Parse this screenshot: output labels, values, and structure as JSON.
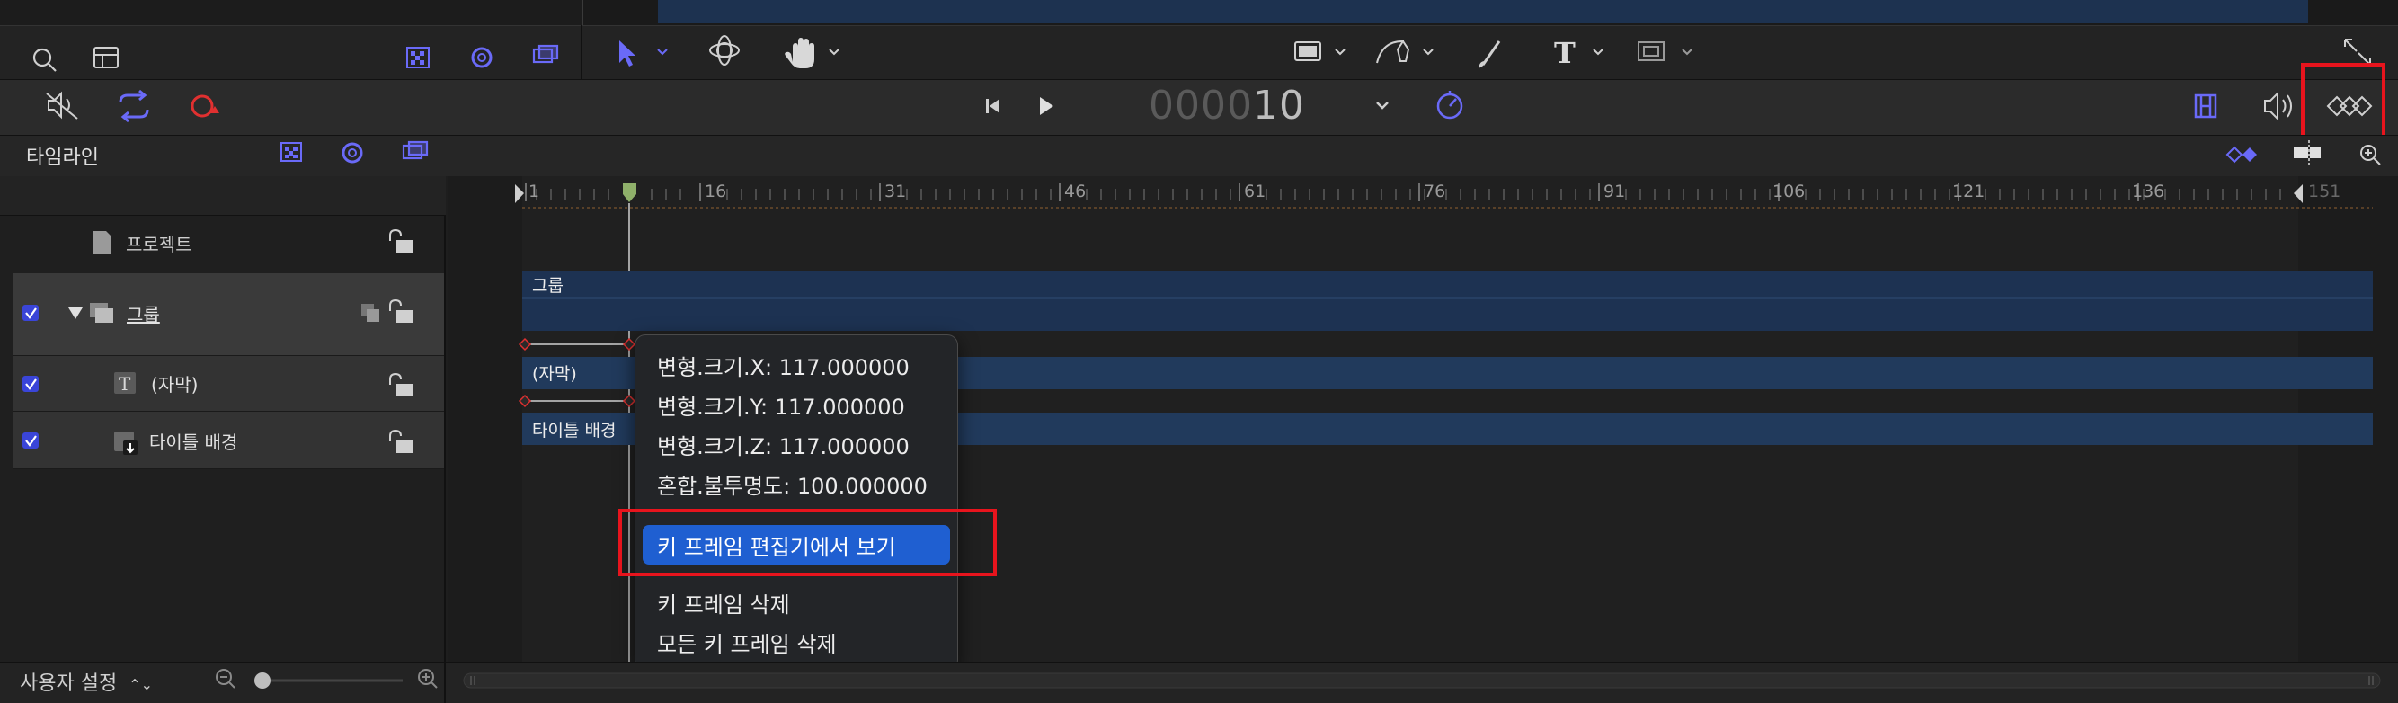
{
  "timeline": {
    "title": "타임라인",
    "layers": [
      {
        "name": "프로젝트"
      },
      {
        "name": "그룹"
      },
      {
        "name": "(자막)"
      },
      {
        "name": "타이틀 배경"
      }
    ]
  },
  "transport": {
    "timecode_dim": "0000",
    "timecode_bright": "10"
  },
  "ruler": {
    "ticks": [
      "1",
      "16",
      "31",
      "46",
      "61",
      "76",
      "91",
      "106",
      "121",
      "136",
      "151"
    ]
  },
  "tracks": {
    "group_label": "그룹",
    "caption_label": "(자막)",
    "title_bg_label": "타이틀 배경"
  },
  "context_menu": {
    "items": [
      "변형.크기.X: 117.000000",
      "변형.크기.Y: 117.000000",
      "변형.크기.Z: 117.000000",
      "혼합.불투명도: 100.000000"
    ],
    "selected": "키 프레임 편집기에서 보기",
    "delete": "키 프레임 삭제",
    "delete_all": "모든 키 프레임 삭제"
  },
  "footer": {
    "preset": "사용자 설정",
    "preset_arrow": "⌃⌄"
  },
  "colors": {
    "accent": "#5b5bf5",
    "selection": "#1f5fd1",
    "track": "#213a5c",
    "highlight_box": "#e8141d",
    "keyframe": "#e03030"
  },
  "icons": [
    "search-icon",
    "sidebar-icon",
    "checker-icon",
    "gear-icon",
    "layers-icon",
    "arrow-select-icon",
    "orbit-icon",
    "hand-icon",
    "rectangle-icon",
    "pen-icon",
    "brush-icon",
    "text-icon",
    "mask-icon",
    "expand-icon",
    "mute-icon",
    "loop-icon",
    "record-icon",
    "skip-back-icon",
    "play-icon",
    "clock-icon",
    "filmstrip-icon",
    "speaker-icon",
    "keyframe-diamonds-icon",
    "zoom-icon",
    "lock-icon",
    "document-icon",
    "checkbox-icon"
  ]
}
